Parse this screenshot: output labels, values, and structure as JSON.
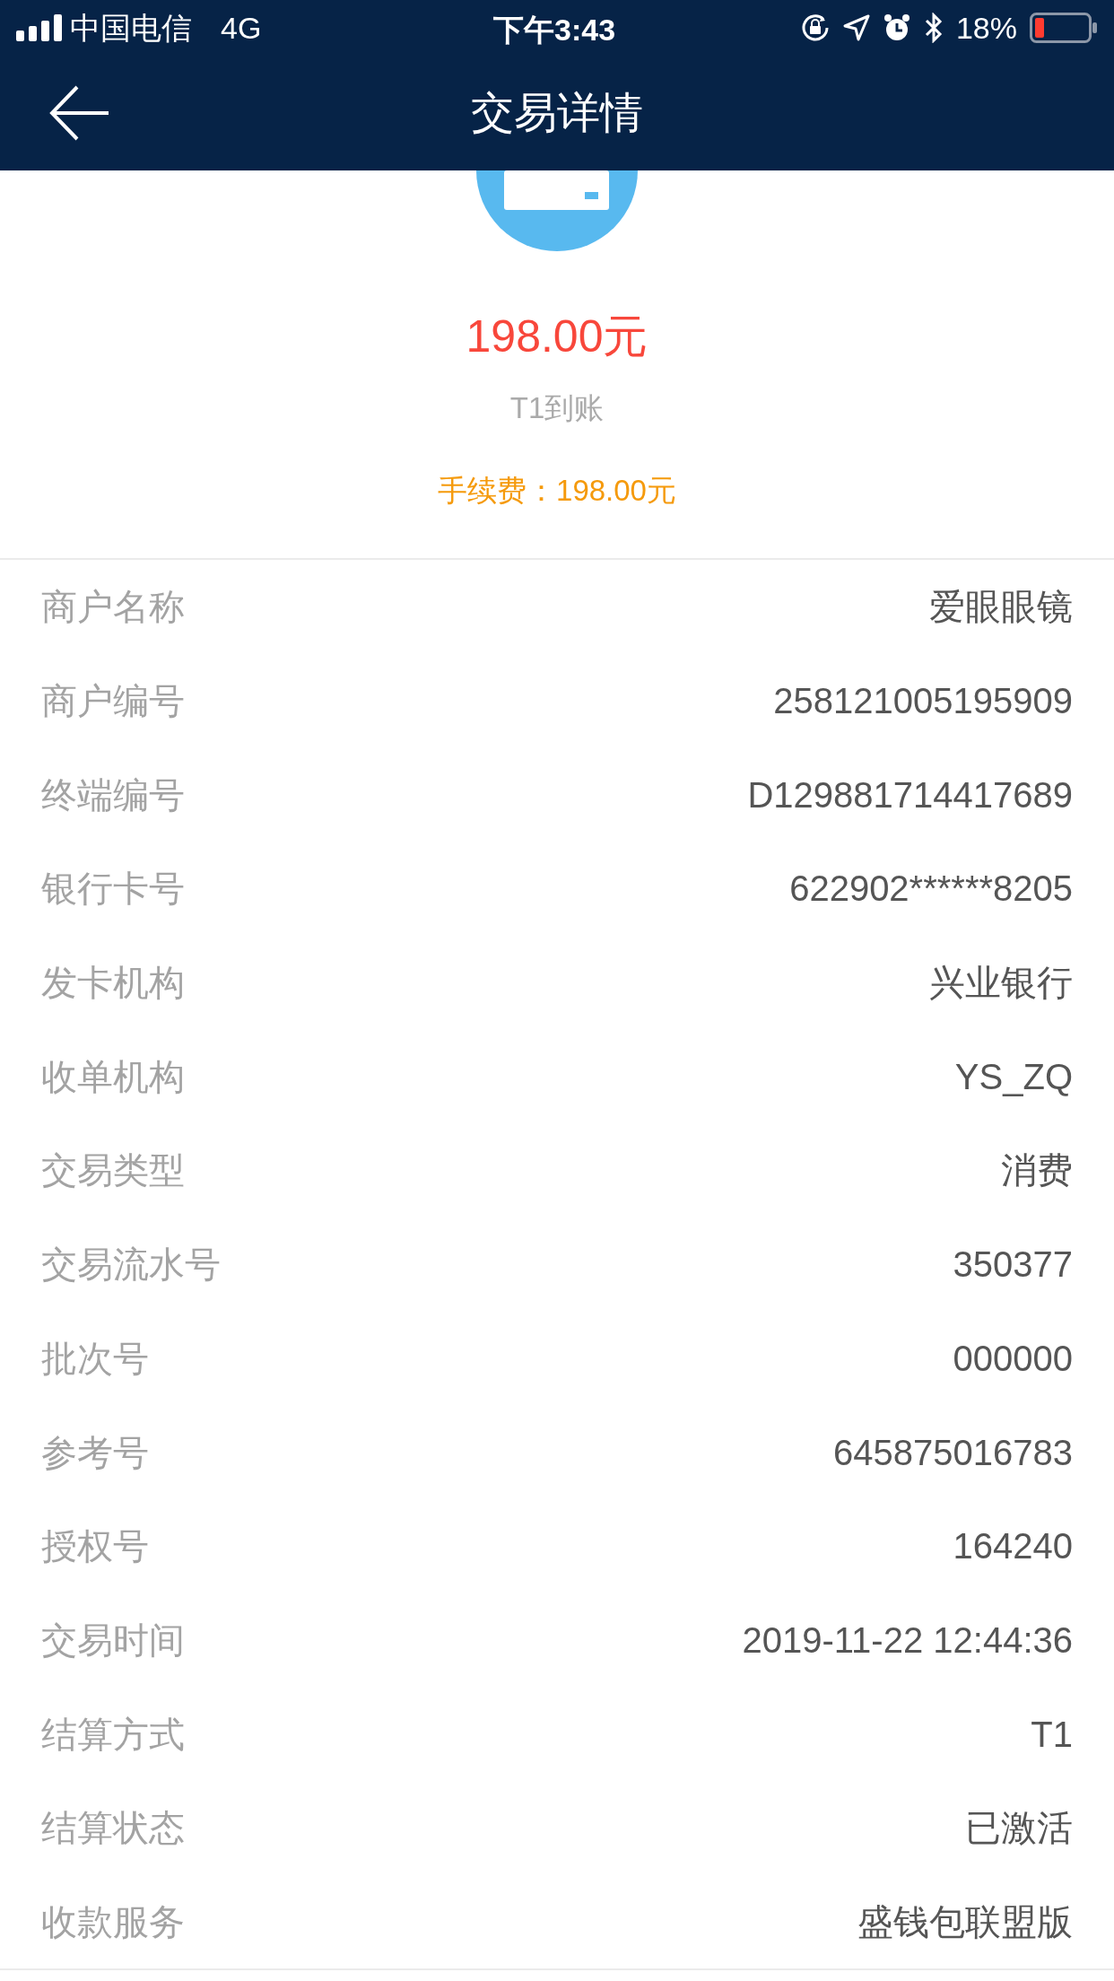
{
  "status_bar": {
    "carrier": "中国电信",
    "network": "4G",
    "time": "下午3:43",
    "battery": "18%"
  },
  "header": {
    "title": "交易详情"
  },
  "summary": {
    "amount": "198.00元",
    "settlement": "T1到账",
    "fee": "手续费：198.00元"
  },
  "details": [
    {
      "label": "商户名称",
      "value": "爱眼眼镜"
    },
    {
      "label": "商户编号",
      "value": "258121005195909"
    },
    {
      "label": "终端编号",
      "value": "D129881714417689"
    },
    {
      "label": "银行卡号",
      "value": "622902******8205"
    },
    {
      "label": "发卡机构",
      "value": "兴业银行"
    },
    {
      "label": "收单机构",
      "value": "YS_ZQ"
    },
    {
      "label": "交易类型",
      "value": "消费"
    },
    {
      "label": "交易流水号",
      "value": "350377"
    },
    {
      "label": "批次号",
      "value": "000000"
    },
    {
      "label": "参考号",
      "value": "645875016783"
    },
    {
      "label": "授权号",
      "value": "164240"
    },
    {
      "label": "交易时间",
      "value": "2019-11-22 12:44:36"
    },
    {
      "label": "结算方式",
      "value": "T1"
    },
    {
      "label": "结算状态",
      "value": "已激活"
    },
    {
      "label": "收款服务",
      "value": "盛钱包联盟版"
    }
  ]
}
